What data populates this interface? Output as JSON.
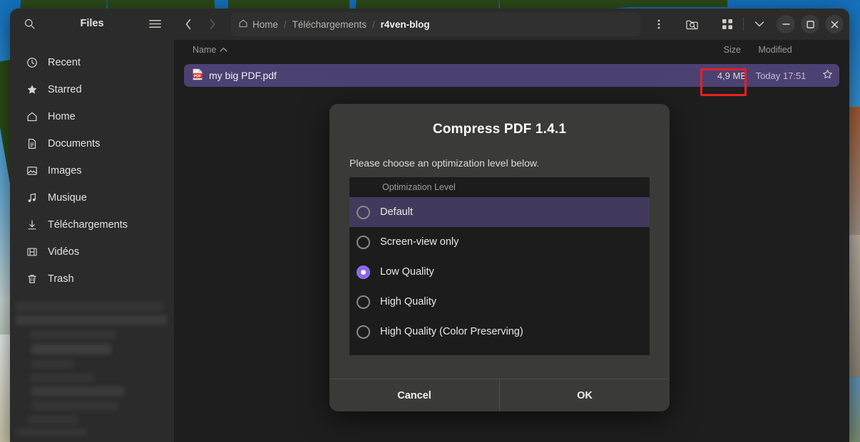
{
  "window": {
    "app_title": "Files",
    "sidebar": {
      "search_icon": "search-icon",
      "menu_icon": "hamburger-menu-icon",
      "items": [
        {
          "label": "Recent",
          "icon": "clock-icon"
        },
        {
          "label": "Starred",
          "icon": "star-icon"
        },
        {
          "label": "Home",
          "icon": "home-icon"
        },
        {
          "label": "Documents",
          "icon": "document-icon"
        },
        {
          "label": "Images",
          "icon": "image-icon"
        },
        {
          "label": "Musique",
          "icon": "music-note-icon"
        },
        {
          "label": "Téléchargements",
          "icon": "download-arrow-icon"
        },
        {
          "label": "Vidéos",
          "icon": "film-icon"
        },
        {
          "label": "Trash",
          "icon": "trash-icon"
        }
      ]
    },
    "topbar": {
      "back_icon": "chevron-left-icon",
      "forward_icon": "chevron-right-icon",
      "breadcrumbs": [
        {
          "label": "Home",
          "icon": "home-icon",
          "current": false
        },
        {
          "label": "Téléchargements",
          "icon": "",
          "current": false
        },
        {
          "label": "r4ven-blog",
          "icon": "",
          "current": true
        }
      ],
      "separator": "/",
      "overflow_icon": "kebab-menu-icon",
      "search_folder_icon": "folder-search-icon",
      "grid_view_icon": "grid-view-icon",
      "view_dropdown_icon": "chevron-down-icon",
      "minimize_label": "—",
      "maximize_label": "▢",
      "close_label": "✕"
    },
    "columns": {
      "name": "Name",
      "sort_icon": "sort-ascending-icon",
      "size": "Size",
      "modified": "Modified"
    },
    "files": [
      {
        "name": "my big PDF.pdf",
        "icon": "pdf-file-icon",
        "size": "4,9 MB",
        "modified": "Today 17:51",
        "star_icon": "star-outline-icon",
        "selected": true
      }
    ],
    "annotation": {
      "target": "4,9 MB",
      "color": "#e8201f"
    }
  },
  "dialog": {
    "title": "Compress PDF 1.4.1",
    "subtitle": "Please choose an optimization level below.",
    "table_header": "Optimization Level",
    "options": [
      {
        "label": "Default",
        "selected": false,
        "hovered": true
      },
      {
        "label": "Screen-view only",
        "selected": false,
        "hovered": false
      },
      {
        "label": "Low Quality",
        "selected": true,
        "hovered": false
      },
      {
        "label": "High Quality",
        "selected": false,
        "hovered": false
      },
      {
        "label": "High Quality (Color Preserving)",
        "selected": false,
        "hovered": false
      }
    ],
    "cancel_label": "Cancel",
    "ok_label": "OK",
    "accent_color": "#8b63ec"
  }
}
